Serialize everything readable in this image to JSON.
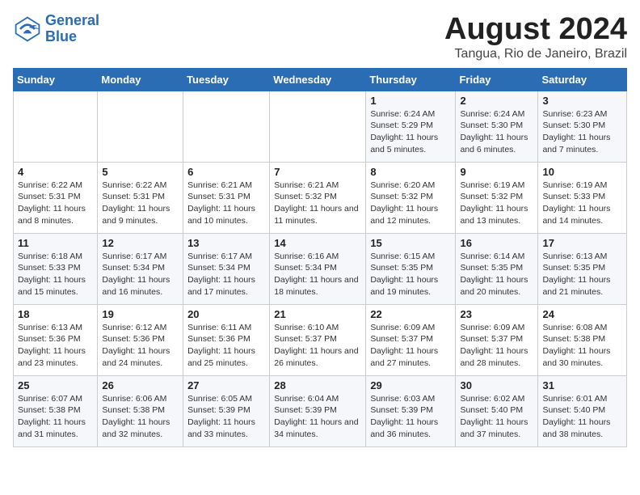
{
  "logo": {
    "line1": "General",
    "line2": "Blue"
  },
  "title": "August 2024",
  "subtitle": "Tangua, Rio de Janeiro, Brazil",
  "days_of_week": [
    "Sunday",
    "Monday",
    "Tuesday",
    "Wednesday",
    "Thursday",
    "Friday",
    "Saturday"
  ],
  "weeks": [
    [
      {
        "day": "",
        "text": ""
      },
      {
        "day": "",
        "text": ""
      },
      {
        "day": "",
        "text": ""
      },
      {
        "day": "",
        "text": ""
      },
      {
        "day": "1",
        "text": "Sunrise: 6:24 AM\nSunset: 5:29 PM\nDaylight: 11 hours and 5 minutes."
      },
      {
        "day": "2",
        "text": "Sunrise: 6:24 AM\nSunset: 5:30 PM\nDaylight: 11 hours and 6 minutes."
      },
      {
        "day": "3",
        "text": "Sunrise: 6:23 AM\nSunset: 5:30 PM\nDaylight: 11 hours and 7 minutes."
      }
    ],
    [
      {
        "day": "4",
        "text": "Sunrise: 6:22 AM\nSunset: 5:31 PM\nDaylight: 11 hours and 8 minutes."
      },
      {
        "day": "5",
        "text": "Sunrise: 6:22 AM\nSunset: 5:31 PM\nDaylight: 11 hours and 9 minutes."
      },
      {
        "day": "6",
        "text": "Sunrise: 6:21 AM\nSunset: 5:31 PM\nDaylight: 11 hours and 10 minutes."
      },
      {
        "day": "7",
        "text": "Sunrise: 6:21 AM\nSunset: 5:32 PM\nDaylight: 11 hours and 11 minutes."
      },
      {
        "day": "8",
        "text": "Sunrise: 6:20 AM\nSunset: 5:32 PM\nDaylight: 11 hours and 12 minutes."
      },
      {
        "day": "9",
        "text": "Sunrise: 6:19 AM\nSunset: 5:32 PM\nDaylight: 11 hours and 13 minutes."
      },
      {
        "day": "10",
        "text": "Sunrise: 6:19 AM\nSunset: 5:33 PM\nDaylight: 11 hours and 14 minutes."
      }
    ],
    [
      {
        "day": "11",
        "text": "Sunrise: 6:18 AM\nSunset: 5:33 PM\nDaylight: 11 hours and 15 minutes."
      },
      {
        "day": "12",
        "text": "Sunrise: 6:17 AM\nSunset: 5:34 PM\nDaylight: 11 hours and 16 minutes."
      },
      {
        "day": "13",
        "text": "Sunrise: 6:17 AM\nSunset: 5:34 PM\nDaylight: 11 hours and 17 minutes."
      },
      {
        "day": "14",
        "text": "Sunrise: 6:16 AM\nSunset: 5:34 PM\nDaylight: 11 hours and 18 minutes."
      },
      {
        "day": "15",
        "text": "Sunrise: 6:15 AM\nSunset: 5:35 PM\nDaylight: 11 hours and 19 minutes."
      },
      {
        "day": "16",
        "text": "Sunrise: 6:14 AM\nSunset: 5:35 PM\nDaylight: 11 hours and 20 minutes."
      },
      {
        "day": "17",
        "text": "Sunrise: 6:13 AM\nSunset: 5:35 PM\nDaylight: 11 hours and 21 minutes."
      }
    ],
    [
      {
        "day": "18",
        "text": "Sunrise: 6:13 AM\nSunset: 5:36 PM\nDaylight: 11 hours and 23 minutes."
      },
      {
        "day": "19",
        "text": "Sunrise: 6:12 AM\nSunset: 5:36 PM\nDaylight: 11 hours and 24 minutes."
      },
      {
        "day": "20",
        "text": "Sunrise: 6:11 AM\nSunset: 5:36 PM\nDaylight: 11 hours and 25 minutes."
      },
      {
        "day": "21",
        "text": "Sunrise: 6:10 AM\nSunset: 5:37 PM\nDaylight: 11 hours and 26 minutes."
      },
      {
        "day": "22",
        "text": "Sunrise: 6:09 AM\nSunset: 5:37 PM\nDaylight: 11 hours and 27 minutes."
      },
      {
        "day": "23",
        "text": "Sunrise: 6:09 AM\nSunset: 5:37 PM\nDaylight: 11 hours and 28 minutes."
      },
      {
        "day": "24",
        "text": "Sunrise: 6:08 AM\nSunset: 5:38 PM\nDaylight: 11 hours and 30 minutes."
      }
    ],
    [
      {
        "day": "25",
        "text": "Sunrise: 6:07 AM\nSunset: 5:38 PM\nDaylight: 11 hours and 31 minutes."
      },
      {
        "day": "26",
        "text": "Sunrise: 6:06 AM\nSunset: 5:38 PM\nDaylight: 11 hours and 32 minutes."
      },
      {
        "day": "27",
        "text": "Sunrise: 6:05 AM\nSunset: 5:39 PM\nDaylight: 11 hours and 33 minutes."
      },
      {
        "day": "28",
        "text": "Sunrise: 6:04 AM\nSunset: 5:39 PM\nDaylight: 11 hours and 34 minutes."
      },
      {
        "day": "29",
        "text": "Sunrise: 6:03 AM\nSunset: 5:39 PM\nDaylight: 11 hours and 36 minutes."
      },
      {
        "day": "30",
        "text": "Sunrise: 6:02 AM\nSunset: 5:40 PM\nDaylight: 11 hours and 37 minutes."
      },
      {
        "day": "31",
        "text": "Sunrise: 6:01 AM\nSunset: 5:40 PM\nDaylight: 11 hours and 38 minutes."
      }
    ]
  ]
}
